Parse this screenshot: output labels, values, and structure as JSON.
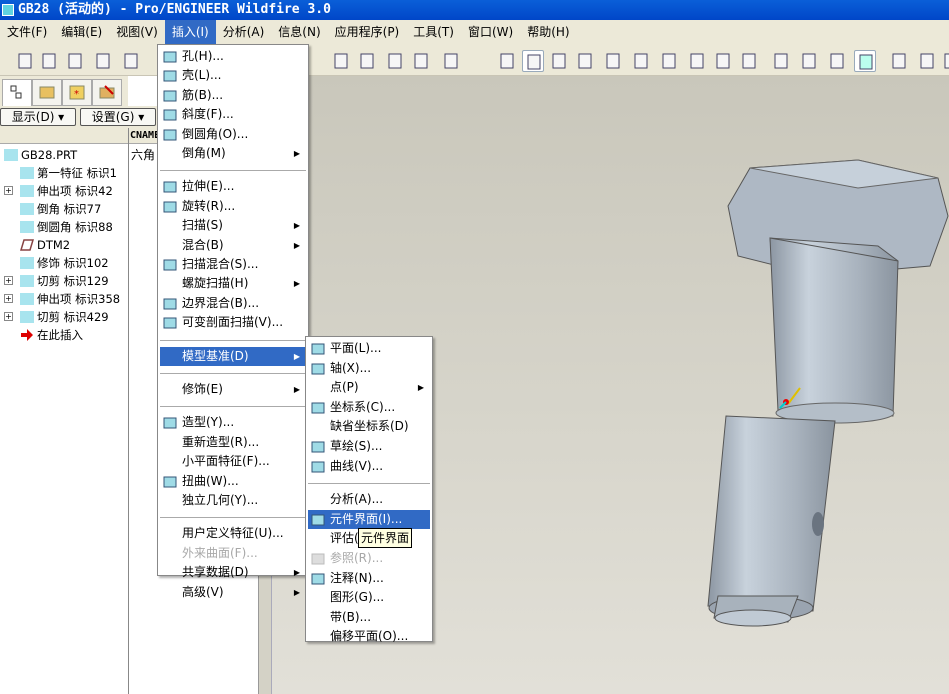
{
  "window": {
    "title": "GB28 (活动的) - Pro/ENGINEER Wildfire 3.0"
  },
  "menubar": [
    "文件(F)",
    "编辑(E)",
    "视图(V)",
    "插入(I)",
    "分析(A)",
    "信息(N)",
    "应用程序(P)",
    "工具(T)",
    "窗口(W)",
    "帮助(H)"
  ],
  "panel": {
    "show_button": "显示(D) ▾",
    "settings_button": "设置(G) ▾",
    "column_header": "CNAME",
    "column_value": "六角"
  },
  "tree": [
    {
      "label": "GB28.PRT",
      "icon": "part-icon",
      "expand": false
    },
    {
      "label": "第一特征 标识1",
      "icon": "feature-icon",
      "expand": false
    },
    {
      "label": "伸出项 标识42",
      "icon": "extrude-icon",
      "expand": true
    },
    {
      "label": "倒角 标识77",
      "icon": "chamfer-icon",
      "expand": false
    },
    {
      "label": "倒圆角 标识88",
      "icon": "round-icon",
      "expand": false
    },
    {
      "label": "DTM2",
      "icon": "datum-plane-icon",
      "expand": false
    },
    {
      "label": "修饰 标识102",
      "icon": "cosmetic-icon",
      "expand": false
    },
    {
      "label": "切剪 标识129",
      "icon": "revolve-icon",
      "expand": true
    },
    {
      "label": "伸出项 标识358",
      "icon": "revolve-icon",
      "expand": true
    },
    {
      "label": "切剪 标识429",
      "icon": "extrude-icon",
      "expand": true
    },
    {
      "label": "在此插入",
      "icon": "insert-here-arrow-icon",
      "expand": false
    }
  ],
  "insert_menu": [
    {
      "label": "孔(H)...",
      "icon": "hole-icon"
    },
    {
      "label": "壳(L)...",
      "icon": "shell-icon"
    },
    {
      "label": "筋(B)...",
      "icon": "rib-icon"
    },
    {
      "label": "斜度(F)...",
      "icon": "draft-icon"
    },
    {
      "label": "倒圆角(O)...",
      "icon": "round-icon"
    },
    {
      "label": "倒角(M)",
      "submenu": true
    },
    {
      "sep": true
    },
    {
      "label": "拉伸(E)...",
      "icon": "extrude-icon"
    },
    {
      "label": "旋转(R)...",
      "icon": "revolve-icon"
    },
    {
      "label": "扫描(S)",
      "submenu": true
    },
    {
      "label": "混合(B)",
      "submenu": true
    },
    {
      "label": "扫描混合(S)...",
      "icon": "swept-blend-icon"
    },
    {
      "label": "螺旋扫描(H)",
      "submenu": true
    },
    {
      "label": "边界混合(B)...",
      "icon": "boundary-blend-icon"
    },
    {
      "label": "可变剖面扫描(V)...",
      "icon": "variable-sweep-icon"
    },
    {
      "sep": true
    },
    {
      "label": "模型基准(D)",
      "submenu": true,
      "highlight": true
    },
    {
      "sep": true
    },
    {
      "label": "修饰(E)",
      "submenu": true
    },
    {
      "sep": true
    },
    {
      "label": "造型(Y)...",
      "icon": "style-icon"
    },
    {
      "label": "重新造型(R)..."
    },
    {
      "label": "小平面特征(F)..."
    },
    {
      "label": "扭曲(W)...",
      "icon": "warp-icon"
    },
    {
      "label": "独立几何(Y)..."
    },
    {
      "sep": true
    },
    {
      "label": "用户定义特征(U)..."
    },
    {
      "label": "外来曲面(F)...",
      "disabled": true
    },
    {
      "label": "共享数据(D)",
      "submenu": true
    },
    {
      "label": "高级(V)",
      "submenu": true
    }
  ],
  "datum_menu": [
    {
      "label": "平面(L)...",
      "icon": "datum-plane-icon"
    },
    {
      "label": "轴(X)...",
      "icon": "datum-axis-icon"
    },
    {
      "label": "点(P)",
      "submenu": true
    },
    {
      "label": "坐标系(C)...",
      "icon": "coordinate-system-icon"
    },
    {
      "label": "缺省坐标系(D)"
    },
    {
      "label": "草绘(S)...",
      "icon": "sketch-icon"
    },
    {
      "label": "曲线(V)...",
      "icon": "curve-icon"
    },
    {
      "sep": true
    },
    {
      "label": "分析(A)..."
    },
    {
      "label": "元件界面(I)...",
      "icon": "component-interface-icon",
      "highlight": true
    },
    {
      "label": "评估(E)..."
    },
    {
      "label": "参照(R)...",
      "icon": "reference-icon",
      "disabled": true
    },
    {
      "label": "注释(N)...",
      "icon": "note-icon"
    },
    {
      "label": "图形(G)..."
    },
    {
      "label": "带(B)..."
    },
    {
      "label": "偏移平面(O)..."
    }
  ],
  "tooltip": "元件界面",
  "colors": {
    "highlight": "#316ac5",
    "title_bar": "#0a5fd8",
    "viewport": "#d8d6cc",
    "model": "#b8c4d0"
  }
}
